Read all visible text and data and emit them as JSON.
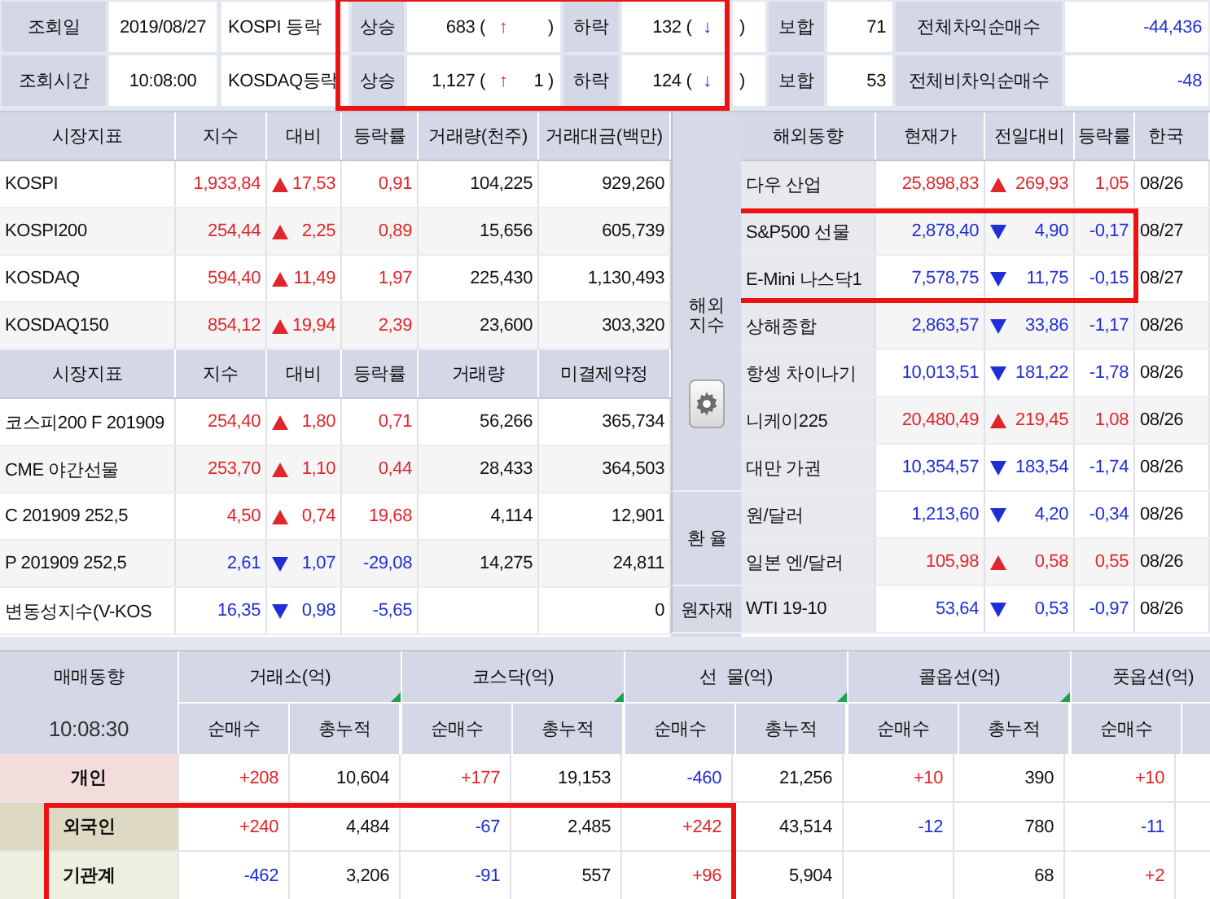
{
  "top": {
    "rows": [
      {
        "date_label": "조회일",
        "date_value": "2019/08/27",
        "market": "KOSPI 등락",
        "up_label": "상승",
        "up_count": "683 (",
        "up_arrow": "↑",
        "up_tail": ")",
        "down_label": "하락",
        "down_count": "132 (",
        "down_arrow": "↓",
        "down_tail": ")",
        "flat_label": "보합",
        "flat_count": "71",
        "arb_label": "전체차익순매수",
        "arb_value": "-44,436",
        "arb_rising": false,
        "highlighted": true
      },
      {
        "date_label": "조회시간",
        "date_value": "10:08:00",
        "market": "KOSDAQ등락",
        "up_label": "상승",
        "up_count": "1,127 (",
        "up_arrow": "↑",
        "up_tail": "1 )",
        "down_label": "하락",
        "down_count": "124 (",
        "down_arrow": "↓",
        "down_tail": ")",
        "flat_label": "보합",
        "flat_count": "53",
        "arb_label": "전체비차익순매수",
        "arb_value": "-48",
        "arb_rising": false,
        "highlighted": true
      }
    ]
  },
  "left": {
    "sections": [
      {
        "columns": [
          "시장지표",
          "지수",
          "대비",
          "등락률",
          "거래량(천주)",
          "거래대금(백만)"
        ],
        "rows": [
          {
            "name": "KOSPI",
            "value": "1,933,84",
            "rising": true,
            "change": "17,53",
            "rate": "0,91",
            "volume": "104,225",
            "amount": "929,260"
          },
          {
            "name": "KOSPI200",
            "value": "254,44",
            "rising": true,
            "change": "2,25",
            "rate": "0,89",
            "volume": "15,656",
            "amount": "605,739"
          },
          {
            "name": "KOSDAQ",
            "value": "594,40",
            "rising": true,
            "change": "11,49",
            "rate": "1,97",
            "volume": "225,430",
            "amount": "1,130,493"
          },
          {
            "name": "KOSDAQ150",
            "value": "854,12",
            "rising": true,
            "change": "19,94",
            "rate": "2,39",
            "volume": "23,600",
            "amount": "303,320"
          }
        ]
      },
      {
        "columns": [
          "시장지표",
          "지수",
          "대비",
          "등락률",
          "거래량",
          "미결제약정"
        ],
        "rows": [
          {
            "name": "코스피200 F 201909",
            "value": "254,40",
            "rising": true,
            "change": "1,80",
            "rate": "0,71",
            "volume": "56,266",
            "amount": "365,734"
          },
          {
            "name": "CME 야간선물",
            "value": "253,70",
            "rising": true,
            "change": "1,10",
            "rate": "0,44",
            "volume": "28,433",
            "amount": "364,503"
          },
          {
            "name": "C 201909 252,5",
            "value": "4,50",
            "rising": true,
            "change": "0,74",
            "rate": "19,68",
            "volume": "4,114",
            "amount": "12,901"
          },
          {
            "name": "P 201909 252,5",
            "value": "2,61",
            "rising": false,
            "change": "1,07",
            "rate": "-29,08",
            "volume": "14,275",
            "amount": "24,811"
          },
          {
            "name": "변동성지수(V-KOS",
            "value": "16,35",
            "rising": false,
            "change": "0,98",
            "rate": "-5,65",
            "amount": "0"
          }
        ]
      }
    ]
  },
  "right": {
    "columns": [
      "해외동향",
      "현재가",
      "전일대비",
      "등락률",
      "한국"
    ],
    "groups": [
      {
        "label": "해외지수",
        "settings_button": true,
        "rows": [
          {
            "name": "다우 산업",
            "value": "25,898,83",
            "rising": true,
            "change": "269,93",
            "rate": "1,05",
            "date": "08/26",
            "highlighted": false
          },
          {
            "name": "S&P500 선물",
            "value": "2,878,40",
            "rising": false,
            "change": "4,90",
            "rate": "-0,17",
            "date": "08/27",
            "highlighted": true
          },
          {
            "name": "E-Mini 나스닥1",
            "value": "7,578,75",
            "rising": false,
            "change": "11,75",
            "rate": "-0,15",
            "date": "08/27",
            "highlighted": true
          },
          {
            "name": "상해종합",
            "value": "2,863,57",
            "rising": false,
            "change": "33,86",
            "rate": "-1,17",
            "date": "08/26",
            "highlighted": false
          },
          {
            "name": "항셍 차이나기",
            "value": "10,013,51",
            "rising": false,
            "change": "181,22",
            "rate": "-1,78",
            "date": "08/26",
            "highlighted": false
          },
          {
            "name": "니케이225",
            "value": "20,480,49",
            "rising": true,
            "change": "219,45",
            "rate": "1,08",
            "date": "08/26",
            "highlighted": false
          },
          {
            "name": "대만 가권",
            "value": "10,354,57",
            "rising": false,
            "change": "183,54",
            "rate": "-1,74",
            "date": "08/26",
            "highlighted": false
          }
        ]
      },
      {
        "label": "환 율",
        "settings_button": false,
        "rows": [
          {
            "name": "원/달러",
            "value": "1,213,60",
            "rising": false,
            "change": "4,20",
            "rate": "-0,34",
            "date": "08/26",
            "highlighted": false
          },
          {
            "name": "일본 엔/달러",
            "value": "105,98",
            "rising": true,
            "change": "0,58",
            "rate": "0,55",
            "date": "08/26",
            "highlighted": false
          }
        ]
      },
      {
        "label": "원자재",
        "settings_button": false,
        "rows": [
          {
            "name": "WTI 19-10",
            "value": "53,64",
            "rising": false,
            "change": "0,53",
            "rate": "-0,97",
            "date": "08/26",
            "highlighted": false
          }
        ]
      }
    ]
  },
  "trading": {
    "title": "매매동향",
    "time": "10:08:30",
    "groups": [
      {
        "label": "거래소(억)",
        "sub": [
          "순매수",
          "총누적"
        ]
      },
      {
        "label": "코스닥(억)",
        "sub": [
          "순매수",
          "총누적"
        ]
      },
      {
        "label": "선  물(억)",
        "sub": [
          "순매수",
          "총누적"
        ]
      },
      {
        "label": "콜옵션(억)",
        "sub": [
          "순매수",
          "총누적"
        ]
      },
      {
        "label": "풋옵션(억)",
        "sub": [
          "순매수"
        ]
      }
    ],
    "rows": [
      {
        "label": "개인",
        "color": "#f2dcdc",
        "highlighted": false,
        "cells": [
          {
            "net": "+208",
            "up": true,
            "total": "10,604"
          },
          {
            "net": "+177",
            "up": true,
            "total": "19,153"
          },
          {
            "net": "-460",
            "up": false,
            "total": "21,256"
          },
          {
            "net": "+10",
            "up": true,
            "total": "390"
          },
          {
            "net": "+10",
            "up": true
          }
        ]
      },
      {
        "label": "외국인",
        "color": "#ddd9c3",
        "highlighted": true,
        "cells": [
          {
            "net": "+240",
            "up": true,
            "total": "4,484"
          },
          {
            "net": "-67",
            "up": false,
            "total": "2,485"
          },
          {
            "net": "+242",
            "up": true,
            "total": "43,514"
          },
          {
            "net": "-12",
            "up": false,
            "total": "780"
          },
          {
            "net": "-11",
            "up": false
          }
        ]
      },
      {
        "label": "기관계",
        "color": "#ebf1de",
        "highlighted": true,
        "cells": [
          {
            "net": "-462",
            "up": false,
            "total": "3,206"
          },
          {
            "net": "-91",
            "up": false,
            "total": "557"
          },
          {
            "net": "+96",
            "up": true,
            "total": "5,904"
          },
          {
            "total": "68"
          },
          {
            "net": "+2",
            "up": true
          }
        ]
      }
    ]
  }
}
